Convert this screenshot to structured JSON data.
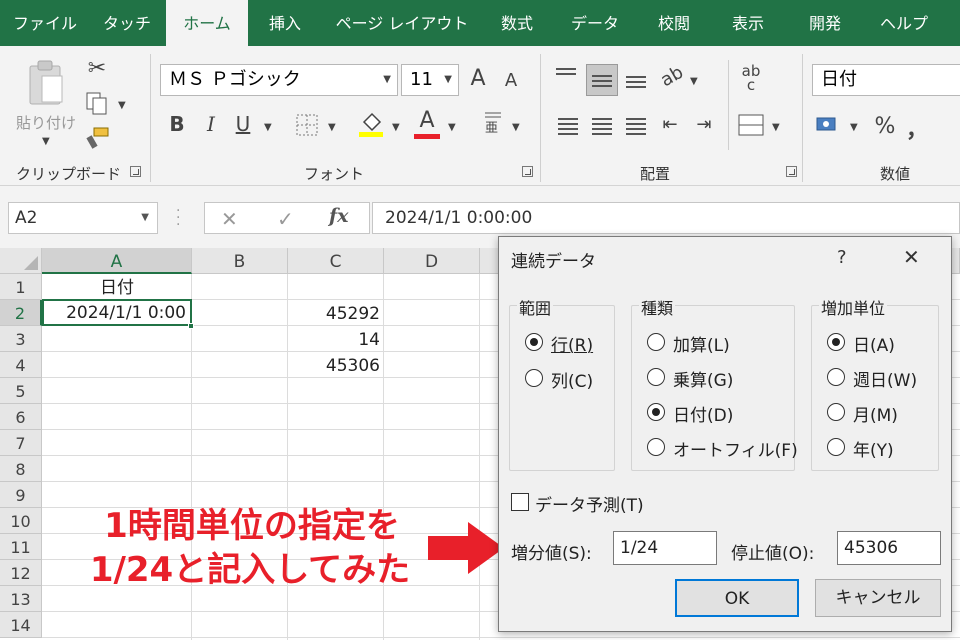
{
  "tabs": [
    "ファイル",
    "タッチ",
    "ホーム",
    "挿入",
    "ページ レイアウト",
    "数式",
    "データ",
    "校閲",
    "表示",
    "開発",
    "ヘルプ"
  ],
  "active_tab": "ホーム",
  "ribbon": {
    "clipboard": {
      "paste_label": "貼り付け",
      "group_label": "クリップボード"
    },
    "font": {
      "font_name": "ＭＳ Ｐゴシック",
      "font_size": "11",
      "grow": "A",
      "shrink": "A",
      "bold": "B",
      "italic": "I",
      "underline": "U",
      "font_color_letter": "A",
      "group_label": "フォント"
    },
    "alignment": {
      "group_label": "配置",
      "wrap_text": "ab c"
    },
    "number": {
      "format": "日付",
      "percent": "%",
      "comma": "，",
      "group_label": "数値"
    }
  },
  "formula_bar": {
    "name_box": "A2",
    "cancel": "✕",
    "enter": "✓",
    "fx": "fx",
    "content": "2024/1/1   0:00:00"
  },
  "grid": {
    "columns": [
      "A",
      "B",
      "C",
      "D"
    ],
    "rows": [
      "1",
      "2",
      "3",
      "4",
      "5",
      "6",
      "7",
      "8",
      "9",
      "10",
      "11",
      "12",
      "13",
      "14"
    ],
    "cells": {
      "A1": "日付",
      "A2": "2024/1/1 0:00",
      "C2": "45292",
      "C3": "14",
      "C4": "45306"
    }
  },
  "dialog": {
    "title": "連続データ",
    "help": "?",
    "close": "✕",
    "range": {
      "label": "範囲",
      "options": [
        "行(R)",
        "列(C)"
      ],
      "selected": 0
    },
    "type": {
      "label": "種類",
      "options": [
        "加算(L)",
        "乗算(G)",
        "日付(D)",
        "オートフィル(F)"
      ],
      "selected": 2
    },
    "unit": {
      "label": "増加単位",
      "options": [
        "日(A)",
        "週日(W)",
        "月(M)",
        "年(Y)"
      ],
      "selected": 0
    },
    "trend": {
      "label": "データ予測(T)",
      "checked": false
    },
    "step": {
      "label": "増分値(S):",
      "value": "1/24"
    },
    "stop": {
      "label": "停止値(O):",
      "value": "45306"
    },
    "ok": "OK",
    "cancel": "キャンセル"
  },
  "annotation": {
    "line1": "1時間単位の指定を",
    "line2": "1/24と記入してみた",
    "color": "#e8202a"
  }
}
